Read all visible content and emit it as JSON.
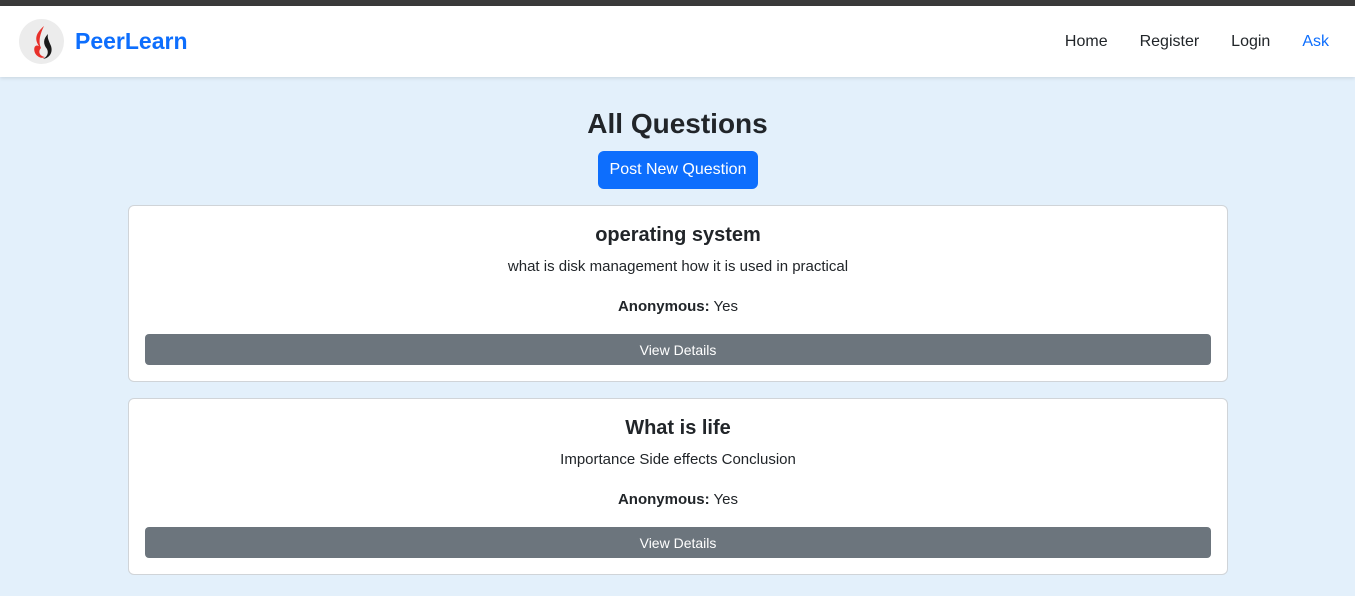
{
  "navbar": {
    "brand_name": "PeerLearn",
    "links": [
      {
        "label": "Home"
      },
      {
        "label": "Register"
      },
      {
        "label": "Login"
      },
      {
        "label": "Ask"
      }
    ]
  },
  "main": {
    "title": "All Questions",
    "post_button_label": "Post New Question",
    "questions": [
      {
        "title": "operating system",
        "description": "what is disk management how it is used in practical",
        "anonymous_label": "Anonymous:",
        "anonymous_value": "Yes",
        "details_label": "View Details"
      },
      {
        "title": "What is life",
        "description": "Importance Side effects Conclusion",
        "anonymous_label": "Anonymous:",
        "anonymous_value": "Yes",
        "details_label": "View Details"
      }
    ]
  },
  "colors": {
    "primary": "#0d6efd",
    "secondary": "#6c757d",
    "background": "#e3f0fb"
  },
  "icons": {
    "logo": "flame-logo-icon"
  }
}
